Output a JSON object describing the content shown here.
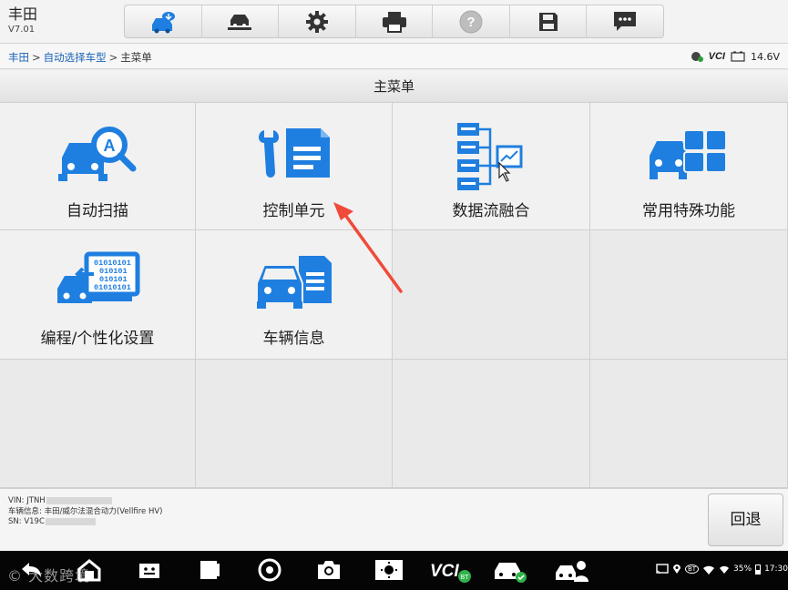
{
  "app": {
    "brand": "丰田",
    "version": "V7.01"
  },
  "toolbar": {
    "tools": [
      {
        "icon": "vehicle-cloud-icon",
        "active": true
      },
      {
        "icon": "vehicle-lift-icon"
      },
      {
        "icon": "gear-icon"
      },
      {
        "icon": "printer-icon"
      },
      {
        "icon": "help-icon",
        "disabled": true
      },
      {
        "icon": "save-icon"
      },
      {
        "icon": "message-icon"
      }
    ]
  },
  "breadcrumb": {
    "item1": "丰田",
    "item2": "自动选择车型",
    "current": "主菜单",
    "sep": ">"
  },
  "status": {
    "vci": "VCI",
    "battery": "14.6V"
  },
  "page_title": "主菜单",
  "menu": [
    {
      "label": "自动扫描",
      "icon": "auto-scan-icon"
    },
    {
      "label": "控制单元",
      "icon": "control-unit-icon"
    },
    {
      "label": "数据流融合",
      "icon": "data-stream-icon"
    },
    {
      "label": "常用特殊功能",
      "icon": "special-functions-icon"
    },
    {
      "label": "编程/个性化设置",
      "icon": "programming-icon"
    },
    {
      "label": "车辆信息",
      "icon": "vehicle-info-icon"
    }
  ],
  "vehicle": {
    "vin": "VIN: JTNH",
    "info": "车辆信息: 丰田/威尔法混合动力(Vellfire HV)",
    "sn": "SN: V19C"
  },
  "back_label": "回退",
  "navbar": {
    "watermark": "大数跨境",
    "battery_pct": "35%",
    "time": "17:30",
    "bt": "BT"
  },
  "colors": {
    "accent": "#1a63b8",
    "icon_blue": "#1f7fe0",
    "arrow": "#f04a3a"
  }
}
